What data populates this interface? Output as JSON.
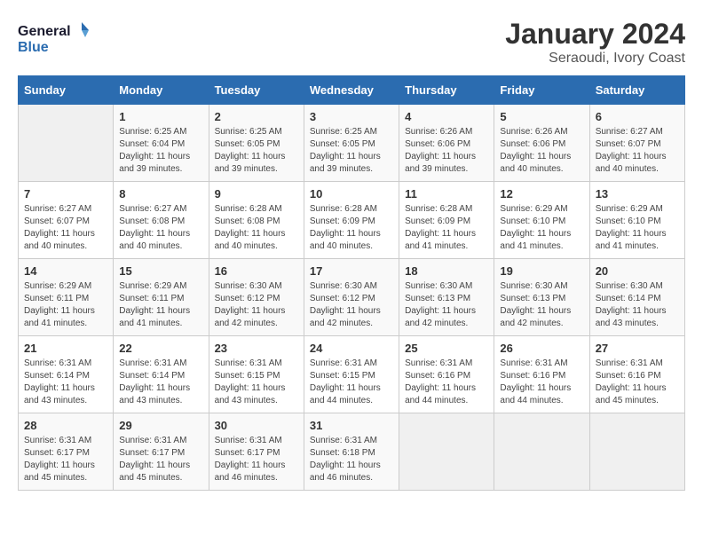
{
  "header": {
    "logo_line1": "General",
    "logo_line2": "Blue",
    "title": "January 2024",
    "subtitle": "Seraoudi, Ivory Coast"
  },
  "weekdays": [
    "Sunday",
    "Monday",
    "Tuesday",
    "Wednesday",
    "Thursday",
    "Friday",
    "Saturday"
  ],
  "weeks": [
    [
      {
        "day": "",
        "sunrise": "",
        "sunset": "",
        "daylight": ""
      },
      {
        "day": "1",
        "sunrise": "Sunrise: 6:25 AM",
        "sunset": "Sunset: 6:04 PM",
        "daylight": "Daylight: 11 hours and 39 minutes."
      },
      {
        "day": "2",
        "sunrise": "Sunrise: 6:25 AM",
        "sunset": "Sunset: 6:05 PM",
        "daylight": "Daylight: 11 hours and 39 minutes."
      },
      {
        "day": "3",
        "sunrise": "Sunrise: 6:25 AM",
        "sunset": "Sunset: 6:05 PM",
        "daylight": "Daylight: 11 hours and 39 minutes."
      },
      {
        "day": "4",
        "sunrise": "Sunrise: 6:26 AM",
        "sunset": "Sunset: 6:06 PM",
        "daylight": "Daylight: 11 hours and 39 minutes."
      },
      {
        "day": "5",
        "sunrise": "Sunrise: 6:26 AM",
        "sunset": "Sunset: 6:06 PM",
        "daylight": "Daylight: 11 hours and 40 minutes."
      },
      {
        "day": "6",
        "sunrise": "Sunrise: 6:27 AM",
        "sunset": "Sunset: 6:07 PM",
        "daylight": "Daylight: 11 hours and 40 minutes."
      }
    ],
    [
      {
        "day": "7",
        "sunrise": "Sunrise: 6:27 AM",
        "sunset": "Sunset: 6:07 PM",
        "daylight": "Daylight: 11 hours and 40 minutes."
      },
      {
        "day": "8",
        "sunrise": "Sunrise: 6:27 AM",
        "sunset": "Sunset: 6:08 PM",
        "daylight": "Daylight: 11 hours and 40 minutes."
      },
      {
        "day": "9",
        "sunrise": "Sunrise: 6:28 AM",
        "sunset": "Sunset: 6:08 PM",
        "daylight": "Daylight: 11 hours and 40 minutes."
      },
      {
        "day": "10",
        "sunrise": "Sunrise: 6:28 AM",
        "sunset": "Sunset: 6:09 PM",
        "daylight": "Daylight: 11 hours and 40 minutes."
      },
      {
        "day": "11",
        "sunrise": "Sunrise: 6:28 AM",
        "sunset": "Sunset: 6:09 PM",
        "daylight": "Daylight: 11 hours and 41 minutes."
      },
      {
        "day": "12",
        "sunrise": "Sunrise: 6:29 AM",
        "sunset": "Sunset: 6:10 PM",
        "daylight": "Daylight: 11 hours and 41 minutes."
      },
      {
        "day": "13",
        "sunrise": "Sunrise: 6:29 AM",
        "sunset": "Sunset: 6:10 PM",
        "daylight": "Daylight: 11 hours and 41 minutes."
      }
    ],
    [
      {
        "day": "14",
        "sunrise": "Sunrise: 6:29 AM",
        "sunset": "Sunset: 6:11 PM",
        "daylight": "Daylight: 11 hours and 41 minutes."
      },
      {
        "day": "15",
        "sunrise": "Sunrise: 6:29 AM",
        "sunset": "Sunset: 6:11 PM",
        "daylight": "Daylight: 11 hours and 41 minutes."
      },
      {
        "day": "16",
        "sunrise": "Sunrise: 6:30 AM",
        "sunset": "Sunset: 6:12 PM",
        "daylight": "Daylight: 11 hours and 42 minutes."
      },
      {
        "day": "17",
        "sunrise": "Sunrise: 6:30 AM",
        "sunset": "Sunset: 6:12 PM",
        "daylight": "Daylight: 11 hours and 42 minutes."
      },
      {
        "day": "18",
        "sunrise": "Sunrise: 6:30 AM",
        "sunset": "Sunset: 6:13 PM",
        "daylight": "Daylight: 11 hours and 42 minutes."
      },
      {
        "day": "19",
        "sunrise": "Sunrise: 6:30 AM",
        "sunset": "Sunset: 6:13 PM",
        "daylight": "Daylight: 11 hours and 42 minutes."
      },
      {
        "day": "20",
        "sunrise": "Sunrise: 6:30 AM",
        "sunset": "Sunset: 6:14 PM",
        "daylight": "Daylight: 11 hours and 43 minutes."
      }
    ],
    [
      {
        "day": "21",
        "sunrise": "Sunrise: 6:31 AM",
        "sunset": "Sunset: 6:14 PM",
        "daylight": "Daylight: 11 hours and 43 minutes."
      },
      {
        "day": "22",
        "sunrise": "Sunrise: 6:31 AM",
        "sunset": "Sunset: 6:14 PM",
        "daylight": "Daylight: 11 hours and 43 minutes."
      },
      {
        "day": "23",
        "sunrise": "Sunrise: 6:31 AM",
        "sunset": "Sunset: 6:15 PM",
        "daylight": "Daylight: 11 hours and 43 minutes."
      },
      {
        "day": "24",
        "sunrise": "Sunrise: 6:31 AM",
        "sunset": "Sunset: 6:15 PM",
        "daylight": "Daylight: 11 hours and 44 minutes."
      },
      {
        "day": "25",
        "sunrise": "Sunrise: 6:31 AM",
        "sunset": "Sunset: 6:16 PM",
        "daylight": "Daylight: 11 hours and 44 minutes."
      },
      {
        "day": "26",
        "sunrise": "Sunrise: 6:31 AM",
        "sunset": "Sunset: 6:16 PM",
        "daylight": "Daylight: 11 hours and 44 minutes."
      },
      {
        "day": "27",
        "sunrise": "Sunrise: 6:31 AM",
        "sunset": "Sunset: 6:16 PM",
        "daylight": "Daylight: 11 hours and 45 minutes."
      }
    ],
    [
      {
        "day": "28",
        "sunrise": "Sunrise: 6:31 AM",
        "sunset": "Sunset: 6:17 PM",
        "daylight": "Daylight: 11 hours and 45 minutes."
      },
      {
        "day": "29",
        "sunrise": "Sunrise: 6:31 AM",
        "sunset": "Sunset: 6:17 PM",
        "daylight": "Daylight: 11 hours and 45 minutes."
      },
      {
        "day": "30",
        "sunrise": "Sunrise: 6:31 AM",
        "sunset": "Sunset: 6:17 PM",
        "daylight": "Daylight: 11 hours and 46 minutes."
      },
      {
        "day": "31",
        "sunrise": "Sunrise: 6:31 AM",
        "sunset": "Sunset: 6:18 PM",
        "daylight": "Daylight: 11 hours and 46 minutes."
      },
      {
        "day": "",
        "sunrise": "",
        "sunset": "",
        "daylight": ""
      },
      {
        "day": "",
        "sunrise": "",
        "sunset": "",
        "daylight": ""
      },
      {
        "day": "",
        "sunrise": "",
        "sunset": "",
        "daylight": ""
      }
    ]
  ]
}
